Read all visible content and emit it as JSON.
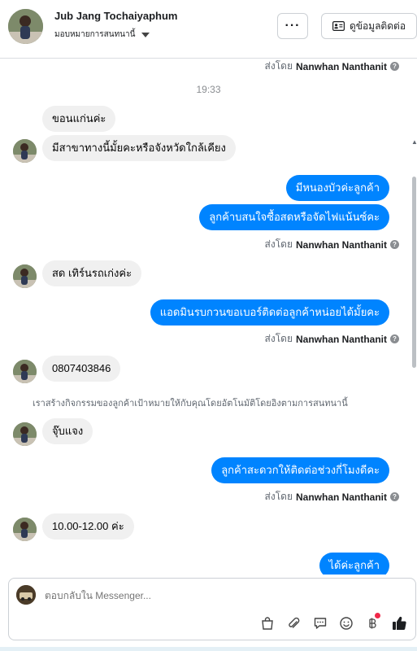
{
  "header": {
    "name": "Jub Jang Tochaiyaphum",
    "assigned": "มอบหมายการสนทนานี้",
    "more_label": "···",
    "contact_label": "ดูข้อมูลติดต่อ"
  },
  "messages": {
    "sent_by_prefix": "ส่งโดย",
    "agent_name": "Nanwhan Nanthanit",
    "info_icon": "?",
    "time1": "19:33",
    "m1": "ขอนแก่นค่ะ",
    "m2": "มีสาขาทางนี้มั้ยคะหรือจังหวัดใกล้เคียง",
    "m3": "มีหนองบัวค่ะลูกค้า",
    "m4": "ลูกค้าบสนใจซื้อสดหรือจัดไฟแน้นซ์คะ",
    "m5": "สด เทิร์นรถเก่งค่ะ",
    "m6": "แอดมินรบกวนขอเบอร์ติดต่อลูกค้าหน่อยได้มั้ยคะ",
    "m7": "0807403846",
    "system_note": "เราสร้างกิจกรรมของลูกค้าเป้าหมายให้กับคุณโดยอัตโนมัติโดยอิงตามการสนทนานี้",
    "m8": "จุ๊บแจง",
    "m9": "ลูกค้าสะดวกให้ติดต่อช่วงกี่โมงดีคะ",
    "m10": "10.00-12.00 ค่ะ",
    "m11": "ได้ค่ะลูกค้า"
  },
  "composer": {
    "placeholder": "ตอบกลับใน Messenger...",
    "tools": [
      "bag-icon",
      "paperclip-icon",
      "quick-reply-icon",
      "emoji-icon",
      "baht-icon",
      "like-icon"
    ]
  },
  "colors": {
    "outgoing": "#0084ff",
    "incoming": "#f0f0f0",
    "notification": "#f02849"
  }
}
